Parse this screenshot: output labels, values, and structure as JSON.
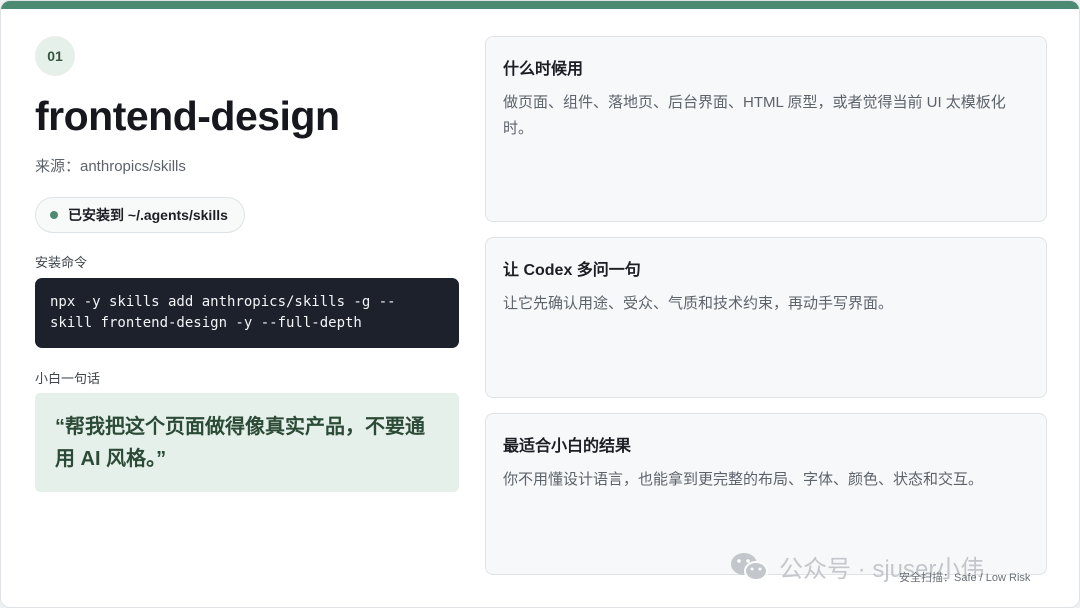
{
  "slide": {
    "number": "01",
    "title": "frontend-design",
    "source": "来源：anthropics/skills",
    "status": "已安装到 ~/.agents/skills",
    "install_label": "安装命令",
    "install_command": "npx -y skills add anthropics/skills -g --\nskill frontend-design -y --full-depth",
    "quote_label": "小白一句话",
    "quote": "“帮我把这个页面做得像真实产品，不要通用 AI 风格。”"
  },
  "cards": [
    {
      "title": "什么时候用",
      "body": "做页面、组件、落地页、后台界面、HTML 原型，或者觉得当前 UI 太模板化时。"
    },
    {
      "title": "让 Codex 多问一句",
      "body": "让它先确认用途、受众、气质和技术约束，再动手写界面。"
    },
    {
      "title": "最适合小白的结果",
      "body": "你不用懂设计语言，也能拿到更完整的布局、字体、颜色、状态和交互。"
    }
  ],
  "watermark": "公众号 · sjuser小伟",
  "footer": "安全扫描：Safe / Low Risk",
  "colors": {
    "accent": "#4d8a72",
    "code_bg": "#1c212c",
    "quote_bg": "#e6f0ea"
  },
  "icons": {
    "watermark": "wechat-icon",
    "status": "status-dot"
  }
}
